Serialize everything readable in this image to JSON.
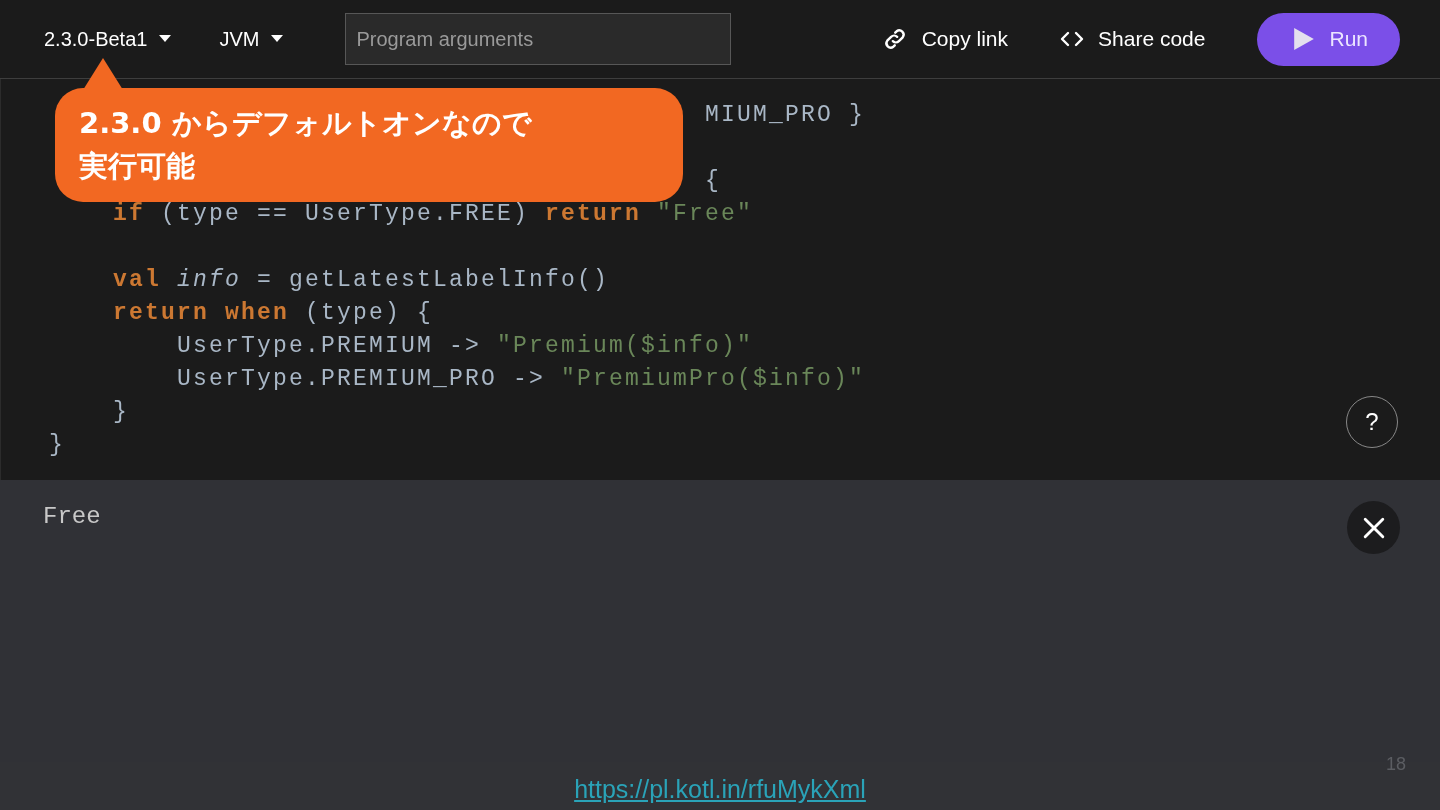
{
  "toolbar": {
    "version": "2.3.0-Beta1",
    "target": "JVM",
    "arguments_field": {
      "placeholder": "Program arguments"
    },
    "copy_link": "Copy link",
    "share_code": "Share code",
    "run": "Run"
  },
  "code_lines": [
    {
      "tokens": [
        {
          "kind": "plain",
          "text": "                                         MIUM_PRO }"
        }
      ]
    },
    {
      "gap_before": true,
      "tokens": [
        {
          "kind": "plain",
          "text": "                                         {"
        }
      ]
    },
    {
      "tokens": [
        {
          "kind": "keyword",
          "text": "    if"
        },
        {
          "kind": "plain",
          "text": " (type == UserType.FREE) "
        },
        {
          "kind": "keyword",
          "text": "return"
        },
        {
          "kind": "string",
          "text": " \"Free\""
        }
      ]
    },
    {
      "gap_before": true,
      "tokens": [
        {
          "kind": "keyword",
          "text": "    val"
        },
        {
          "kind": "variable",
          "text": " info"
        },
        {
          "kind": "plain",
          "text": " = getLatestLabelInfo()"
        }
      ]
    },
    {
      "tokens": [
        {
          "kind": "keyword",
          "text": "    return when"
        },
        {
          "kind": "plain",
          "text": " (type) {"
        }
      ]
    },
    {
      "tokens": [
        {
          "kind": "plain",
          "text": "        UserType.PREMIUM -> "
        },
        {
          "kind": "string",
          "text": "\"Premium($info)\""
        }
      ]
    },
    {
      "tokens": [
        {
          "kind": "plain",
          "text": "        UserType.PREMIUM_PRO -> "
        },
        {
          "kind": "string",
          "text": "\"PremiumPro($info)\""
        }
      ]
    },
    {
      "tokens": [
        {
          "kind": "plain",
          "text": "    }"
        }
      ]
    },
    {
      "tokens": [
        {
          "kind": "plain",
          "text": "}"
        }
      ]
    }
  ],
  "help_button": "?",
  "output": "Free",
  "callout": {
    "lines": [
      "2.3.0 からデフォルトオンなので",
      "実行可能"
    ]
  },
  "slide": {
    "link": "https://pl.kotl.in/rfuMykXml",
    "page_number": "18"
  }
}
